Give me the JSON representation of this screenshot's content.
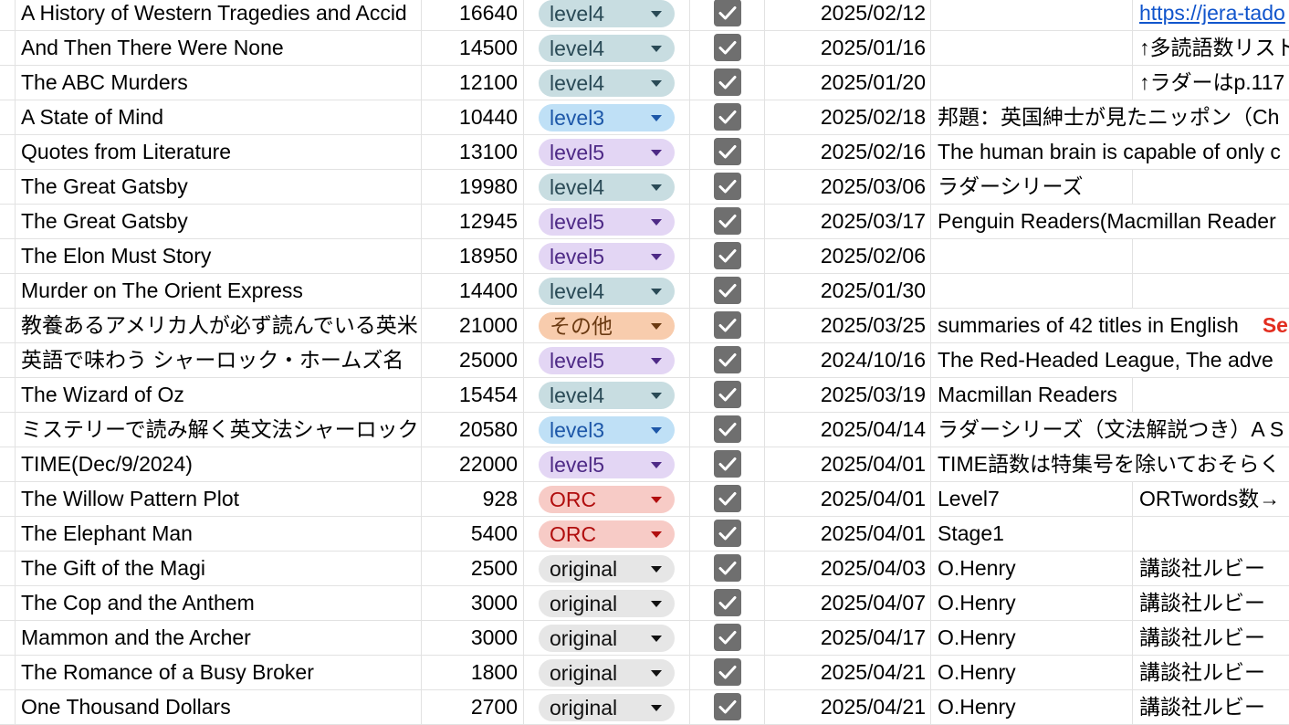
{
  "level_styles": {
    "level4": {
      "bg": "#c8dde1",
      "fg": "#2a4a56",
      "arrow": "#2a4a56"
    },
    "level3": {
      "bg": "#bfe0f6",
      "fg": "#1d57a8",
      "arrow": "#1d57a8"
    },
    "level5": {
      "bg": "#e3d6f4",
      "fg": "#4e2a86",
      "arrow": "#4e2a86"
    },
    "その他": {
      "bg": "#f8ccad",
      "fg": "#6b3a12",
      "arrow": "#6b3a12"
    },
    "ORC": {
      "bg": "#f7cbc6",
      "fg": "#b10e0e",
      "arrow": "#b10e0e"
    },
    "original": {
      "bg": "#e6e6e6",
      "fg": "#111111",
      "arrow": "#111111"
    }
  },
  "rows": [
    {
      "title": "A History of Western Tragedies and Accid",
      "words": "16640",
      "level": "level4",
      "checked": true,
      "date": "2025/02/12",
      "note": "",
      "link": "https://jera-tado",
      "link_type": "url"
    },
    {
      "title": "And Then There Were None",
      "words": "14500",
      "level": "level4",
      "checked": true,
      "date": "2025/01/16",
      "note": "",
      "link": "↑多読語数リスト",
      "link_type": "text"
    },
    {
      "title": "The ABC Murders",
      "words": "12100",
      "level": "level4",
      "checked": true,
      "date": "2025/01/20",
      "note": "",
      "link": "↑ラダーはp.117",
      "link_type": "text"
    },
    {
      "title": "A State of Mind",
      "words": "10440",
      "level": "level3",
      "checked": true,
      "date": "2025/02/18",
      "note": "邦題：英国紳士が見たニッポン（Ch",
      "link": "",
      "link_type": "none"
    },
    {
      "title": "Quotes from Literature",
      "words": "13100",
      "level": "level5",
      "checked": true,
      "date": "2025/02/16",
      "note": "The human brain is capable of only c",
      "link": "",
      "link_type": "none"
    },
    {
      "title": "The Great Gatsby",
      "words": "19980",
      "level": "level4",
      "checked": true,
      "date": "2025/03/06",
      "note": "ラダーシリーズ",
      "link": "",
      "link_type": "blank"
    },
    {
      "title": "The Great Gatsby",
      "words": "12945",
      "level": "level5",
      "checked": true,
      "date": "2025/03/17",
      "note": "Penguin Readers(Macmillan Reader",
      "link": "",
      "link_type": "none"
    },
    {
      "title": "The Elon Must Story",
      "words": "18950",
      "level": "level5",
      "checked": true,
      "date": "2025/02/06",
      "note": "",
      "link": "",
      "link_type": "blank"
    },
    {
      "title": "Murder on The Orient Express",
      "words": "14400",
      "level": "level4",
      "checked": true,
      "date": "2025/01/30",
      "note": "",
      "link": "",
      "link_type": "blank"
    },
    {
      "title": "教養あるアメリカ人が必ず読んでいる英米",
      "words": "21000",
      "level": "その他",
      "checked": true,
      "date": "2025/03/25",
      "note": "summaries of 42 titles in English",
      "note_extra": "Se",
      "link": "",
      "link_type": "none"
    },
    {
      "title": "英語で味わう シャーロック・ホームズ名",
      "words": "25000",
      "level": "level5",
      "checked": true,
      "date": "2024/10/16",
      "note": "The Red-Headed League, The adve",
      "link": "",
      "link_type": "none"
    },
    {
      "title": "The Wizard of Oz",
      "words": "15454",
      "level": "level4",
      "checked": true,
      "date": "2025/03/19",
      "note": "Macmillan Readers",
      "link": "",
      "link_type": "blank"
    },
    {
      "title": "ミステリーで読み解く英文法シャーロック",
      "words": "20580",
      "level": "level3",
      "checked": true,
      "date": "2025/04/14",
      "note": "ラダーシリーズ（文法解説つき）A S",
      "link": "",
      "link_type": "none"
    },
    {
      "title": "TIME(Dec/9/2024)",
      "words": "22000",
      "level": "level5",
      "checked": true,
      "date": "2025/04/01",
      "note": "TIME語数は特集号を除いておそらく",
      "link": "",
      "link_type": "none"
    },
    {
      "title": "The Willow Pattern Plot",
      "words": "928",
      "level": "ORC",
      "checked": true,
      "date": "2025/04/01",
      "note": "Level7",
      "link": "ORTwords数→",
      "link_type": "text"
    },
    {
      "title": "The Elephant Man",
      "words": "5400",
      "level": "ORC",
      "checked": true,
      "date": "2025/04/01",
      "note": "Stage1",
      "link": "",
      "link_type": "blank"
    },
    {
      "title": "The Gift of the Magi",
      "words": "2500",
      "level": "original",
      "checked": true,
      "date": "2025/04/03",
      "note": "O.Henry",
      "link": "講談社ルビー",
      "link_type": "text"
    },
    {
      "title": "The Cop and the Anthem",
      "words": "3000",
      "level": "original",
      "checked": true,
      "date": "2025/04/07",
      "note": "O.Henry",
      "link": "講談社ルビー",
      "link_type": "text"
    },
    {
      "title": "Mammon and the Archer",
      "words": "3000",
      "level": "original",
      "checked": true,
      "date": "2025/04/17",
      "note": "O.Henry",
      "link": "講談社ルビー",
      "link_type": "text"
    },
    {
      "title": "The Romance of a Busy Broker",
      "words": "1800",
      "level": "original",
      "checked": true,
      "date": "2025/04/21",
      "note": "O.Henry",
      "link": "講談社ルビー",
      "link_type": "text"
    },
    {
      "title": "One Thousand Dollars",
      "words": "2700",
      "level": "original",
      "checked": true,
      "date": "2025/04/21",
      "note": "O.Henry",
      "link": "講談社ルビー",
      "link_type": "text"
    }
  ]
}
